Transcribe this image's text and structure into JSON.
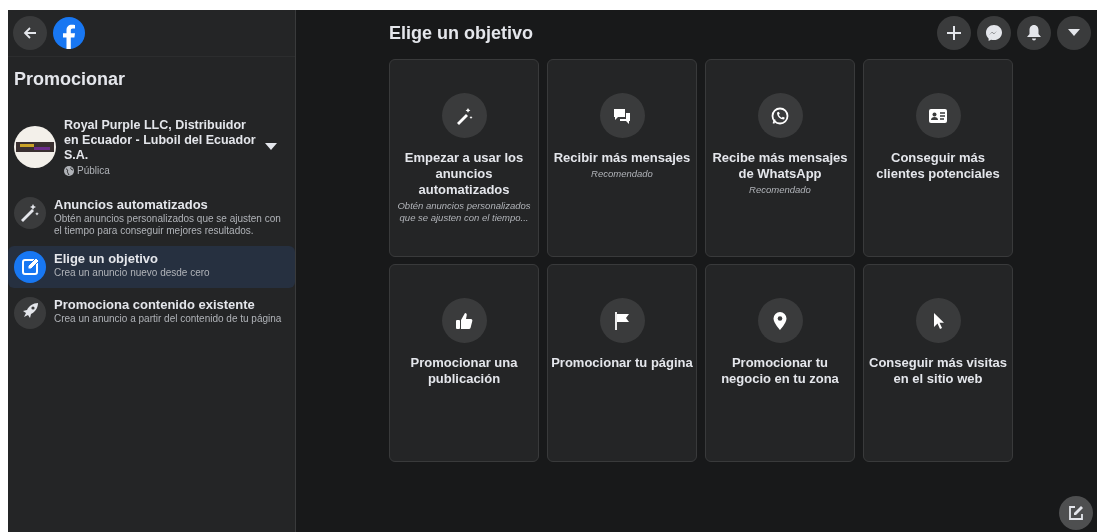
{
  "sidebar": {
    "title": "Promocionar",
    "page": {
      "name": "Royal Purple LLC, Distribuidor en Ecuador - Luboil del Ecuador S.A.",
      "privacy": "Pública"
    },
    "items": [
      {
        "title": "Anuncios automatizados",
        "description": "Obtén anuncios personalizados que se ajusten con el tiempo para conseguir mejores resultados.",
        "selected": false
      },
      {
        "title": "Elige un objetivo",
        "description": "Crea un anuncio nuevo desde cero",
        "selected": true
      },
      {
        "title": "Promociona contenido existente",
        "description": "Crea un anuncio a partir del contenido de tu página",
        "selected": false
      }
    ]
  },
  "main": {
    "title": "Elige un objetivo",
    "objectives": [
      {
        "title": "Empezar a usar los anuncios automatizados",
        "subtitle": "Obtén anuncios personalizados que se ajusten con el tiempo..."
      },
      {
        "title": "Recibir más mensajes",
        "subtitle": "Recomendado"
      },
      {
        "title": "Recibe más mensajes de WhatsApp",
        "subtitle": "Recomendado"
      },
      {
        "title": "Conseguir más clientes potenciales"
      },
      {
        "title": "Promocionar una publicación"
      },
      {
        "title": "Promocionar tu página"
      },
      {
        "title": "Promocionar tu negocio en tu zona"
      },
      {
        "title": "Conseguir más visitas en el sitio web"
      }
    ]
  }
}
